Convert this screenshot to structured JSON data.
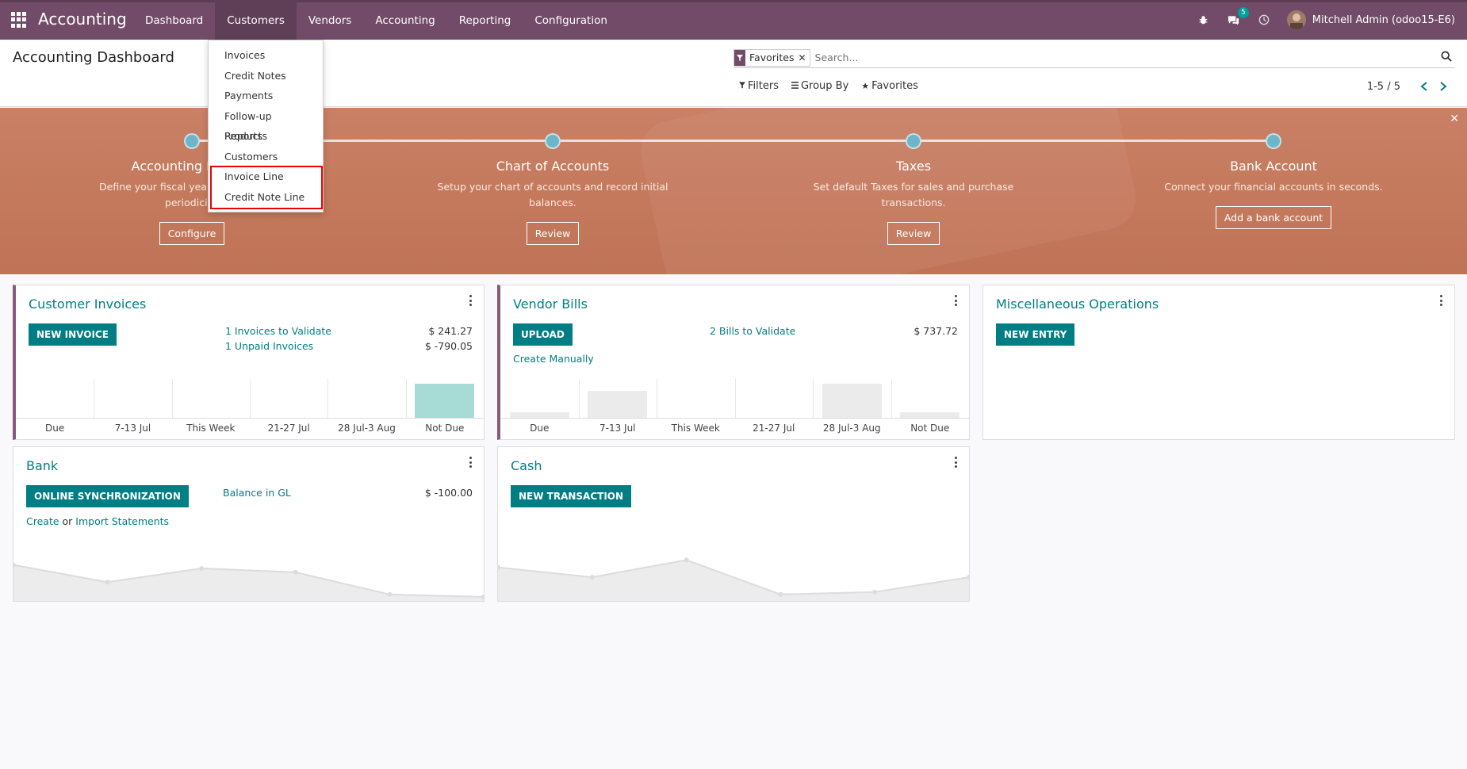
{
  "app": {
    "brand": "Accounting"
  },
  "nav": {
    "items": [
      "Dashboard",
      "Customers",
      "Vendors",
      "Accounting",
      "Reporting",
      "Configuration"
    ],
    "active": "Customers"
  },
  "systray": {
    "messages_count": "5",
    "user": "Mitchell Admin (odoo15-E6)"
  },
  "control_panel": {
    "title": "Accounting Dashboard",
    "facet": "Favorites",
    "search_placeholder": "Search...",
    "filters_label": "Filters",
    "groupby_label": "Group By",
    "favorites_label": "Favorites",
    "pager": "1-5 / 5"
  },
  "customers_menu": {
    "items": [
      "Invoices",
      "Credit Notes",
      "Payments",
      "Follow-up Reports",
      "Products",
      "Customers",
      "Invoice Line",
      "Credit Note Line"
    ],
    "highlighted": [
      "Invoice Line",
      "Credit Note Line"
    ],
    "highlight_color": "#e00000"
  },
  "onboarding": {
    "steps": [
      {
        "title": "Accounting Periods",
        "text": "Define your fiscal years & tax returns periodicity.",
        "button": "Configure"
      },
      {
        "title": "Chart of Accounts",
        "text": "Setup your chart of accounts and record initial balances.",
        "button": "Review"
      },
      {
        "title": "Taxes",
        "text": "Set default Taxes for sales and purchase transactions.",
        "button": "Review"
      },
      {
        "title": "Bank Account",
        "text": "Connect your financial accounts in seconds.",
        "button": "Add a bank account"
      }
    ]
  },
  "colors": {
    "brand": "#714b67",
    "accent": "#017e84",
    "banner": "#c57a5d"
  },
  "journals": {
    "customer_invoices": {
      "title": "Customer Invoices",
      "button": "NEW INVOICE",
      "links": [
        "1 Invoices to Validate",
        "1 Unpaid Invoices"
      ],
      "amounts": [
        "$ 241.27",
        "$ -790.05"
      ],
      "chart": {
        "categories": [
          "Due",
          "7-13 Jul",
          "This Week",
          "21-27 Jul",
          "28 Jul-3 Aug",
          "Not Due"
        ],
        "values": [
          0,
          0,
          0,
          0,
          0,
          1
        ],
        "bar_color": "#a6dbd6"
      }
    },
    "vendor_bills": {
      "title": "Vendor Bills",
      "button": "UPLOAD",
      "links": [
        "2 Bills to Validate"
      ],
      "create_link": "Create Manually",
      "amounts": [
        "$ 737.72"
      ],
      "chart": {
        "categories": [
          "Due",
          "7-13 Jul",
          "This Week",
          "21-27 Jul",
          "28 Jul-3 Aug",
          "Not Due"
        ],
        "values": [
          0.18,
          0.8,
          0,
          0,
          1,
          0.18
        ],
        "bar_color": "#ebebeb"
      }
    },
    "misc": {
      "title": "Miscellaneous Operations",
      "button": "NEW ENTRY"
    },
    "bank": {
      "title": "Bank",
      "button": "ONLINE SYNCHRONIZATION",
      "link": "Balance in GL",
      "amount": "$ -100.00",
      "create": "Create",
      "or": " or ",
      "import": "Import Statements",
      "line": [
        0.7,
        0.35,
        0.63,
        0.55,
        0.1,
        0.05
      ]
    },
    "cash": {
      "title": "Cash",
      "button": "NEW TRANSACTION",
      "line": [
        0.65,
        0.45,
        0.8,
        0.1,
        0.15,
        0.45
      ]
    }
  }
}
